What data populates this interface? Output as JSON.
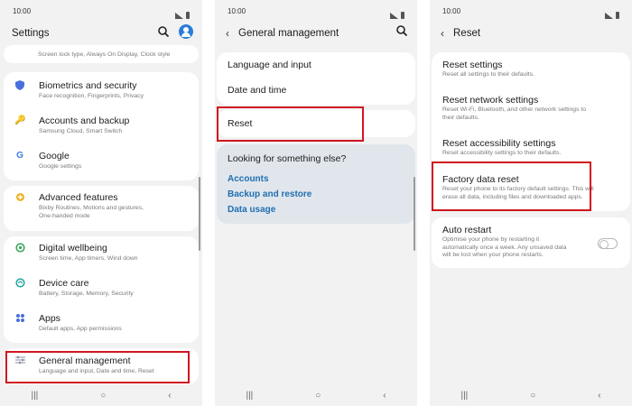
{
  "panel1": {
    "time": "10:00",
    "title": "Settings",
    "top_sub": "Screen lock type, Always On Display, Clock style",
    "items": [
      {
        "title": "Biometrics and security",
        "sub": "Face recognition, Fingerprints, Privacy",
        "icon": "shield-icon",
        "color": "#4a6fdc"
      },
      {
        "title": "Accounts and backup",
        "sub": "Samsung Cloud, Smart Switch",
        "icon": "key-icon",
        "color": "#e2a233"
      },
      {
        "title": "Google",
        "sub": "Google settings",
        "icon": "google-icon",
        "color": "#3a7be0"
      },
      {
        "title": "Advanced features",
        "sub1": "Bixby Routines, Motions and gestures,",
        "sub2": "One-handed mode",
        "icon": "gear-plus-icon",
        "color": "#f0b020"
      },
      {
        "title": "Digital wellbeing",
        "sub": "Screen time, App timers, Wind down",
        "icon": "wellbeing-icon",
        "color": "#3aa65a"
      },
      {
        "title": "Device care",
        "sub": "Battery, Storage, Memory, Security",
        "icon": "device-care-icon",
        "color": "#27a9a0"
      },
      {
        "title": "Apps",
        "sub": "Default apps, App permissions",
        "icon": "apps-icon",
        "color": "#4a6fdc"
      },
      {
        "title": "General management",
        "sub": "Language and input, Date and time, Reset",
        "icon": "sliders-icon",
        "color": "#8a8fa0"
      }
    ]
  },
  "panel2": {
    "time": "10:00",
    "title": "General management",
    "items": [
      "Language and input",
      "Date and time",
      "Reset"
    ],
    "looking_title": "Looking for something else?",
    "links": [
      "Accounts",
      "Backup and restore",
      "Data usage"
    ]
  },
  "panel3": {
    "time": "10:00",
    "title": "Reset",
    "items": [
      {
        "title": "Reset settings",
        "sub1": "Reset all settings to their defaults.",
        "sub2": ""
      },
      {
        "title": "Reset network settings",
        "sub1": "Reset Wi-Fi, Bluetooth, and other network settings to",
        "sub2": "their defaults."
      },
      {
        "title": "Reset accessibility settings",
        "sub1": "Reset accessibility settings to their defaults.",
        "sub2": ""
      },
      {
        "title": "Factory data reset",
        "sub1": "Reset your phone to its factory default settings. This will",
        "sub2": "erase all data, including files and downloaded apps."
      }
    ],
    "auto_restart": {
      "title": "Auto restart",
      "sub1": "Optimise your phone by restarting it",
      "sub2": "automatically once a week. Any unsaved data",
      "sub3": "will be lost when your phone restarts.",
      "enabled": false
    }
  },
  "navbar": {
    "recents": "|||",
    "home": "○",
    "back": "‹"
  },
  "colors": {
    "highlight": "#d0161f",
    "link": "#1f6fb0"
  }
}
